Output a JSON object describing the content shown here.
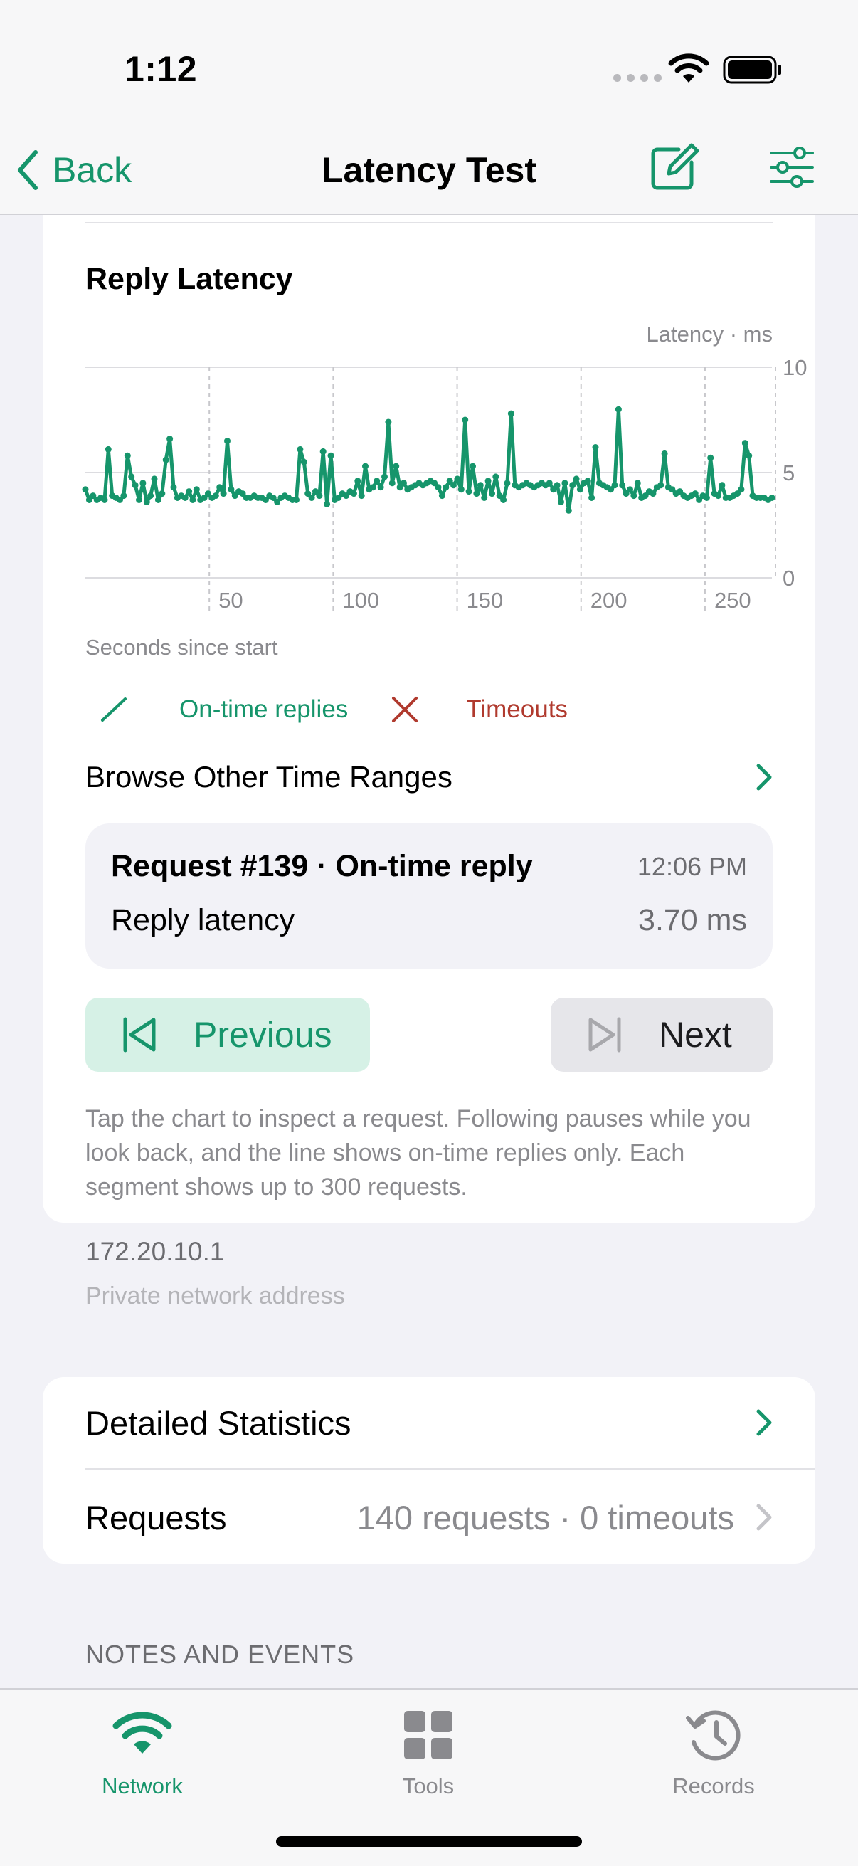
{
  "status": {
    "time": "1:12"
  },
  "nav": {
    "back_label": "Back",
    "title": "Latency Test"
  },
  "colors": {
    "accent": "#16956b",
    "timeout": "#b03a2e",
    "background": "#f2f2f7"
  },
  "chart": {
    "title": "Reply Latency",
    "unit_label": "Latency · ms",
    "xlabel": "Seconds since start"
  },
  "chart_data": {
    "type": "line",
    "title": "Reply Latency",
    "xlabel": "Seconds since start",
    "ylabel": "Latency · ms",
    "xlim": [
      0,
      277
    ],
    "ylim": [
      0,
      10
    ],
    "x_ticks": [
      50,
      100,
      150,
      200,
      250
    ],
    "y_ticks": [
      0,
      5,
      10
    ],
    "y_axis_position": "right",
    "grid": true,
    "series": [
      {
        "name": "On-time replies",
        "values": [
          4.2,
          3.7,
          3.9,
          3.7,
          3.8,
          3.7,
          6.1,
          3.9,
          3.8,
          3.7,
          3.9,
          5.8,
          4.8,
          4.4,
          3.7,
          4.5,
          3.6,
          3.9,
          4.7,
          3.7,
          4.0,
          5.6,
          6.6,
          4.3,
          3.8,
          3.9,
          3.8,
          4.1,
          3.7,
          4.2,
          3.7,
          3.8,
          4.0,
          3.8,
          3.9,
          4.3,
          4.0,
          6.5,
          4.2,
          3.9,
          4.1,
          4.0,
          3.8,
          3.8,
          3.9,
          3.8,
          3.8,
          3.7,
          3.9,
          3.8,
          3.6,
          3.8,
          3.9,
          3.8,
          3.7,
          3.7,
          6.1,
          5.5,
          4.0,
          3.8,
          4.1,
          3.9,
          6.0,
          3.5,
          5.8,
          3.7,
          3.8,
          4.0,
          3.9,
          4.1,
          4.0,
          4.6,
          3.9,
          5.3,
          4.2,
          4.3,
          4.6,
          4.3,
          4.8,
          7.4,
          4.5,
          5.3,
          4.3,
          4.5,
          4.2,
          4.3,
          4.4,
          4.5,
          4.4,
          4.5,
          4.6,
          4.5,
          4.3,
          3.9,
          4.3,
          4.6,
          4.4,
          4.7,
          4.2,
          7.5,
          4.1,
          5.3,
          4.0,
          4.4,
          3.8,
          4.6,
          4.0,
          4.8,
          3.9,
          3.7,
          4.5,
          7.8,
          4.4,
          4.3,
          4.4,
          4.5,
          4.4,
          4.3,
          4.4,
          4.5,
          4.4,
          4.5,
          4.2,
          4.4,
          3.6,
          4.5,
          3.2,
          4.4,
          4.7,
          4.2,
          4.5,
          4.6,
          3.8,
          6.2,
          4.5,
          4.4,
          4.3,
          4.2,
          4.4,
          8.0,
          4.4,
          4.0,
          4.2,
          3.9,
          4.5,
          3.8,
          3.9,
          4.1,
          4.0,
          4.3,
          4.4,
          5.9,
          4.3,
          4.2,
          4.0,
          4.1,
          3.9,
          3.8,
          3.9,
          4.0,
          3.7,
          3.9,
          3.8,
          5.7,
          4.0,
          3.9,
          4.4,
          3.8,
          3.8,
          3.9,
          4.0,
          4.2,
          6.4,
          5.8,
          3.9,
          3.8,
          3.8,
          3.8,
          3.7,
          3.8
        ],
        "color": "#16956b"
      }
    ],
    "legend": [
      {
        "name": "On-time replies",
        "marker": "line"
      },
      {
        "name": "Timeouts",
        "marker": "x"
      }
    ]
  },
  "legend": {
    "ontime": "On-time replies",
    "timeout": "Timeouts"
  },
  "browse": {
    "label": "Browse Other Time Ranges"
  },
  "request": {
    "title": "Request #139 · On-time reply",
    "time": "12:06 PM",
    "label": "Reply latency",
    "value": "3.70 ms"
  },
  "buttons": {
    "previous": "Previous",
    "next": "Next"
  },
  "hint": "Tap the chart to inspect a request. Following pauses while you look back, and the line shows on-time replies only. Each segment shows up to 300 requests.",
  "address": {
    "ip": "172.20.10.1",
    "subtitle": "Private network address"
  },
  "list": {
    "detailed_statistics": "Detailed Statistics",
    "requests_label": "Requests",
    "requests_value": "140 requests · 0 timeouts"
  },
  "section": {
    "notes_header": "NOTES AND EVENTS"
  },
  "tabs": [
    {
      "label": "Network",
      "icon": "wifi-icon"
    },
    {
      "label": "Tools",
      "icon": "grid-icon"
    },
    {
      "label": "Records",
      "icon": "clock-history-icon"
    }
  ]
}
